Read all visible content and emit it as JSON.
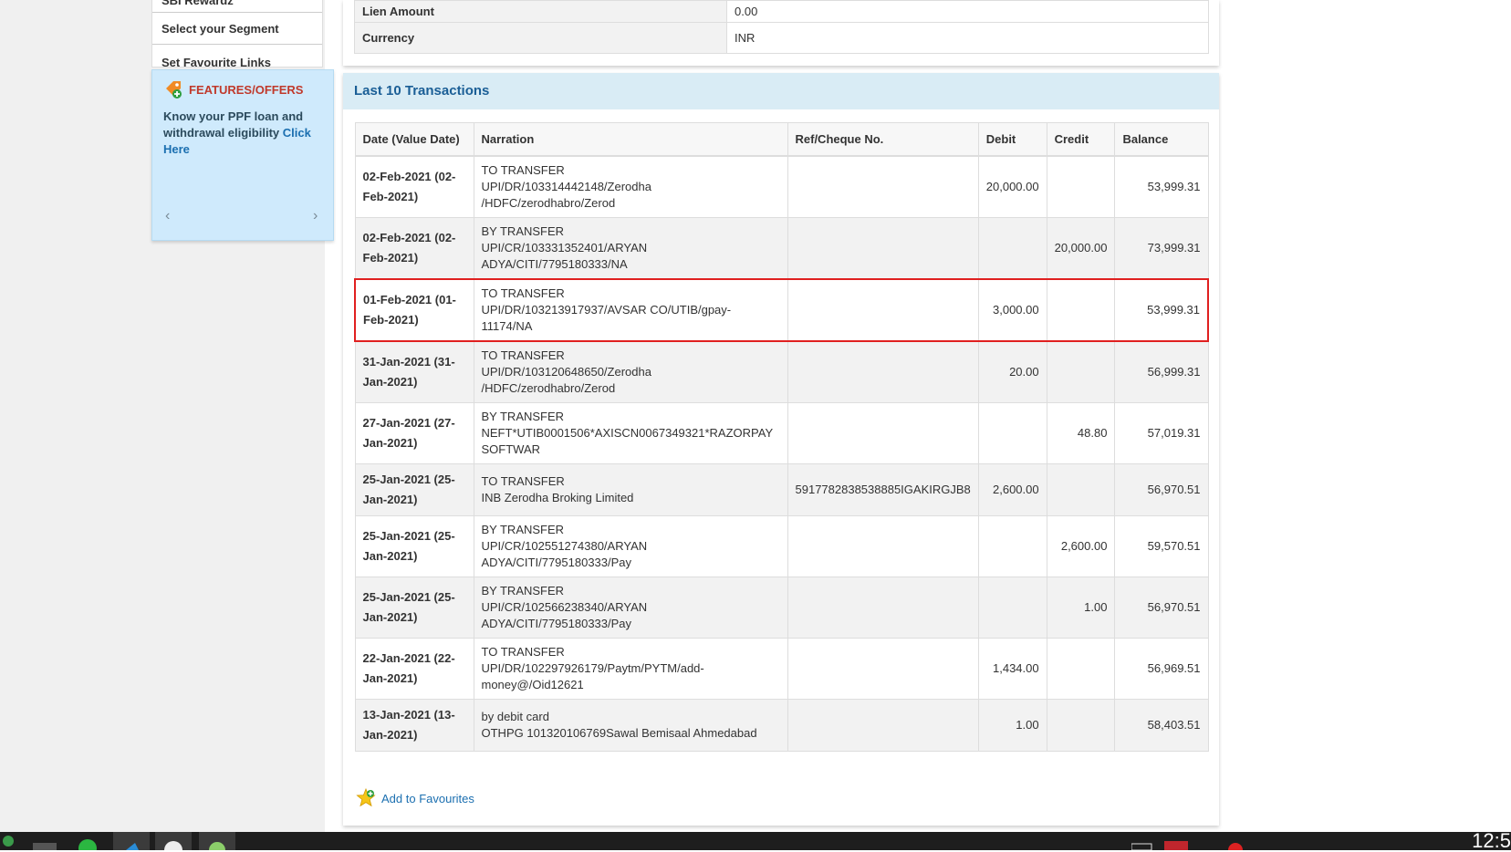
{
  "sidebar": {
    "items": [
      {
        "label": "SBI Rewardz"
      },
      {
        "label": "Select your Segment"
      },
      {
        "label": "Set Favourite Links"
      }
    ]
  },
  "features": {
    "title": "FEATURES/OFFERS",
    "text": "Know your PPF loan and withdrawal eligibility",
    "link": "Click Here",
    "dots_total": 8,
    "active_dot": 6
  },
  "account_details": [
    {
      "key": "Lien Amount",
      "value": "0.00"
    },
    {
      "key": "Currency",
      "value": "INR"
    }
  ],
  "transactions": {
    "title": "Last 10 Transactions",
    "columns": [
      "Date (Value Date)",
      "Narration",
      "Ref/Cheque No.",
      "Debit",
      "Credit",
      "Balance"
    ],
    "rows": [
      {
        "date": "02-Feb-2021 (02-Feb-2021)",
        "n1": "TO TRANSFER",
        "n2": "UPI/DR/103314442148/Zerodha /HDFC/zerodhabro/Zerod",
        "n3": "",
        "ref": "",
        "debit": "20,000.00",
        "credit": "",
        "balance": "53,999.31"
      },
      {
        "date": "02-Feb-2021 (02-Feb-2021)",
        "n1": "BY TRANSFER",
        "n2": "UPI/CR/103331352401/ARYAN ADYA/CITI/7795180333/NA",
        "n3": "",
        "ref": "",
        "debit": "",
        "credit": "20,000.00",
        "balance": "73,999.31"
      },
      {
        "date": "01-Feb-2021 (01-Feb-2021)",
        "n1": "TO TRANSFER",
        "n2": "UPI/DR/103213917937/AVSAR CO/UTIB/gpay-11174/NA",
        "n3": "",
        "ref": "",
        "debit": "3,000.00",
        "credit": "",
        "balance": "53,999.31"
      },
      {
        "date": "31-Jan-2021 (31-Jan-2021)",
        "n1": "TO TRANSFER",
        "n2": "UPI/DR/103120648650/Zerodha /HDFC/zerodhabro/Zerod",
        "n3": "",
        "ref": "",
        "debit": "20.00",
        "credit": "",
        "balance": "56,999.31"
      },
      {
        "date": "27-Jan-2021 (27-Jan-2021)",
        "n1": "BY TRANSFER",
        "n2": "NEFT*UTIB0001506*AXISCN0067349321*RAZORPAY",
        "n3": "SOFTWAR",
        "ref": "",
        "debit": "",
        "credit": "48.80",
        "balance": "57,019.31"
      },
      {
        "date": "25-Jan-2021 (25-Jan-2021)",
        "n1": "TO TRANSFER",
        "n2": "INB Zerodha Broking Limited",
        "n3": "",
        "ref": "5917782838538885IGAKIRGJB8",
        "debit": "2,600.00",
        "credit": "",
        "balance": "56,970.51"
      },
      {
        "date": "25-Jan-2021 (25-Jan-2021)",
        "n1": "BY TRANSFER",
        "n2": "UPI/CR/102551274380/ARYAN",
        "n3": "ADYA/CITI/7795180333/Pay",
        "ref": "",
        "debit": "",
        "credit": "2,600.00",
        "balance": "59,570.51"
      },
      {
        "date": "25-Jan-2021 (25-Jan-2021)",
        "n1": "BY TRANSFER",
        "n2": "UPI/CR/102566238340/ARYAN",
        "n3": "ADYA/CITI/7795180333/Pay",
        "ref": "",
        "debit": "",
        "credit": "1.00",
        "balance": "56,970.51"
      },
      {
        "date": "22-Jan-2021 (22-Jan-2021)",
        "n1": "TO TRANSFER",
        "n2": "UPI/DR/102297926179/Paytm/PYTM/add-",
        "n3": "money@/Oid12621",
        "ref": "",
        "debit": "1,434.00",
        "credit": "",
        "balance": "56,969.51"
      },
      {
        "date": "13-Jan-2021 (13-Jan-2021)",
        "n1": "by debit card",
        "n2": "OTHPG 101320106769Sawal Bemisaal Ahmedabad",
        "n3": "",
        "ref": "",
        "debit": "1.00",
        "credit": "",
        "balance": "58,403.51"
      }
    ],
    "highlighted_row": 2
  },
  "favourites": {
    "label": "Add to Favourites"
  },
  "taskbar": {
    "clock": "12:5"
  }
}
